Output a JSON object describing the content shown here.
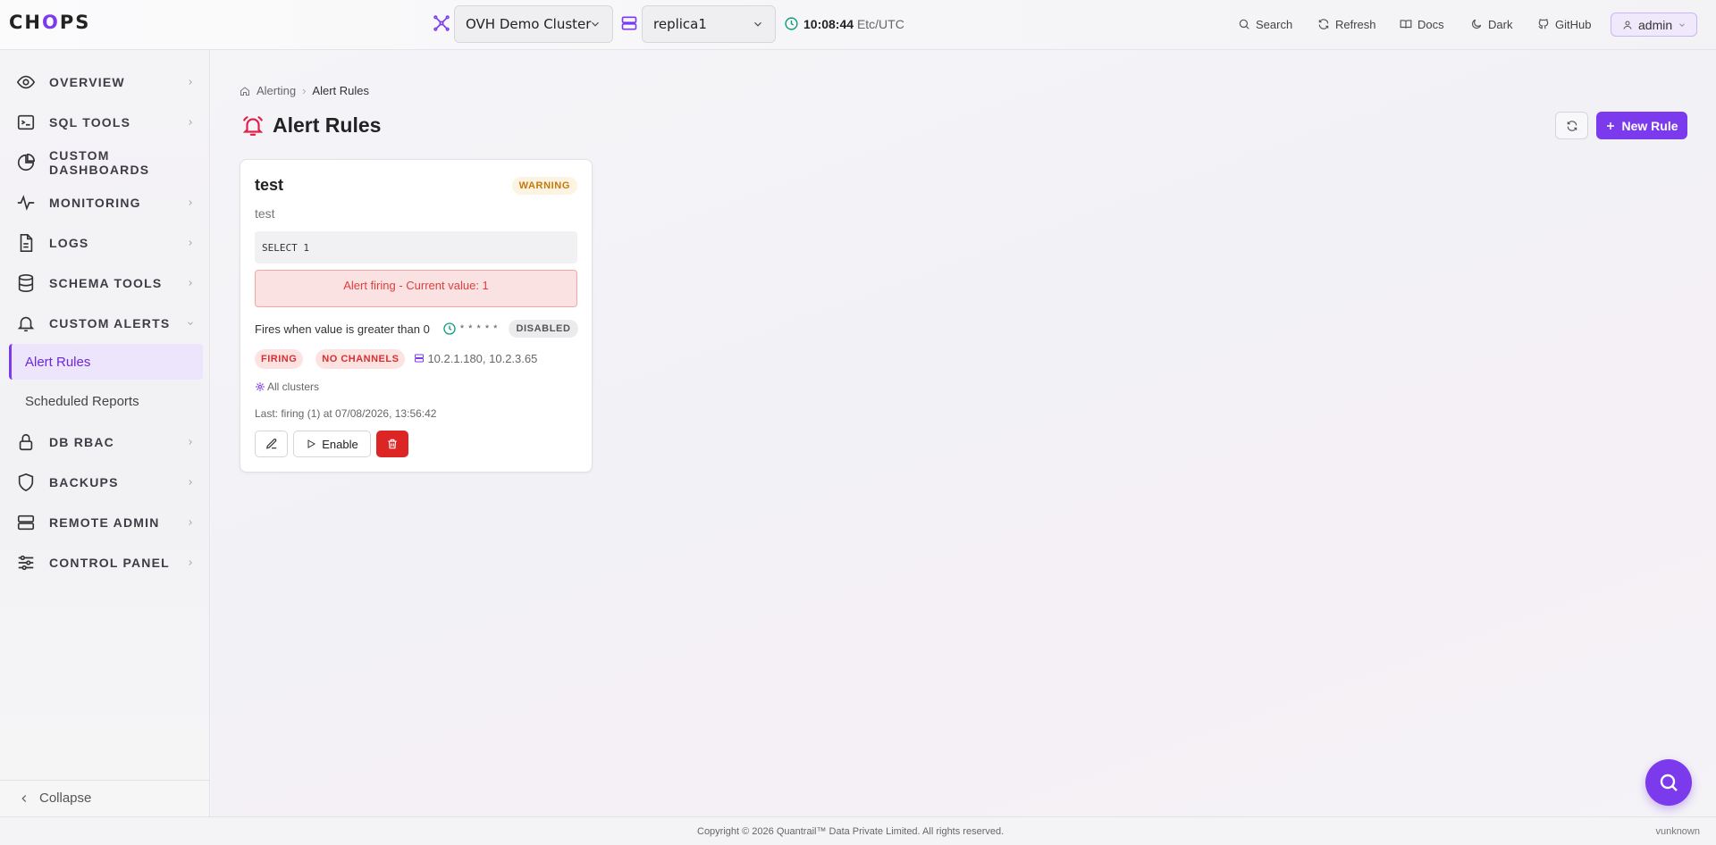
{
  "app": {
    "logo": "CHOPS"
  },
  "header": {
    "cluster_select": "OVH Demo Cluster",
    "replica_select": "replica1",
    "time": "10:08:44",
    "timezone": "Etc/UTC",
    "nav": {
      "search": "Search",
      "refresh": "Refresh",
      "docs": "Docs",
      "dark": "Dark",
      "github": "GitHub"
    },
    "user": "admin"
  },
  "sidebar": {
    "items": [
      {
        "label": "OVERVIEW",
        "icon": "eye-icon"
      },
      {
        "label": "SQL TOOLS",
        "icon": "terminal-icon"
      },
      {
        "label": "CUSTOM DASHBOARDS",
        "icon": "pie-chart-icon"
      },
      {
        "label": "MONITORING",
        "icon": "activity-icon"
      },
      {
        "label": "LOGS",
        "icon": "file-text-icon"
      },
      {
        "label": "SCHEMA TOOLS",
        "icon": "database-icon"
      },
      {
        "label": "CUSTOM ALERTS",
        "icon": "bell-icon"
      },
      {
        "label": "DB RBAC",
        "icon": "lock-icon"
      },
      {
        "label": "BACKUPS",
        "icon": "shield-icon"
      },
      {
        "label": "REMOTE ADMIN",
        "icon": "server-icon"
      },
      {
        "label": "CONTROL PANEL",
        "icon": "sliders-icon"
      }
    ],
    "sub_items": {
      "alert_rules": "Alert Rules",
      "scheduled_reports": "Scheduled Reports"
    },
    "collapse": "Collapse"
  },
  "main": {
    "breadcrumb": {
      "parent": "Alerting",
      "current": "Alert Rules"
    },
    "title": "Alert Rules",
    "new_rule": "New Rule"
  },
  "rule": {
    "name": "test",
    "severity": "WARNING",
    "description": "test",
    "query": "SELECT 1",
    "alert_message": "Alert firing - Current value: 1",
    "condition": "Fires when value is greater than 0",
    "schedule": "* * * * *",
    "status": "DISABLED",
    "state": "FIRING",
    "channels": "NO CHANNELS",
    "hosts": "10.2.1.180, 10.2.3.65",
    "clusters": "All clusters",
    "last": "Last: firing (1) at 07/08/2026, 13:56:42",
    "enable": "Enable"
  },
  "footer": {
    "copyright": "Copyright © 2026 Quantrail™ Data Private Limited. All rights reserved.",
    "version": "vunknown"
  },
  "colors": {
    "accent": "#7c3aed",
    "danger": "#dc2626",
    "warning": "#c47a0a"
  }
}
